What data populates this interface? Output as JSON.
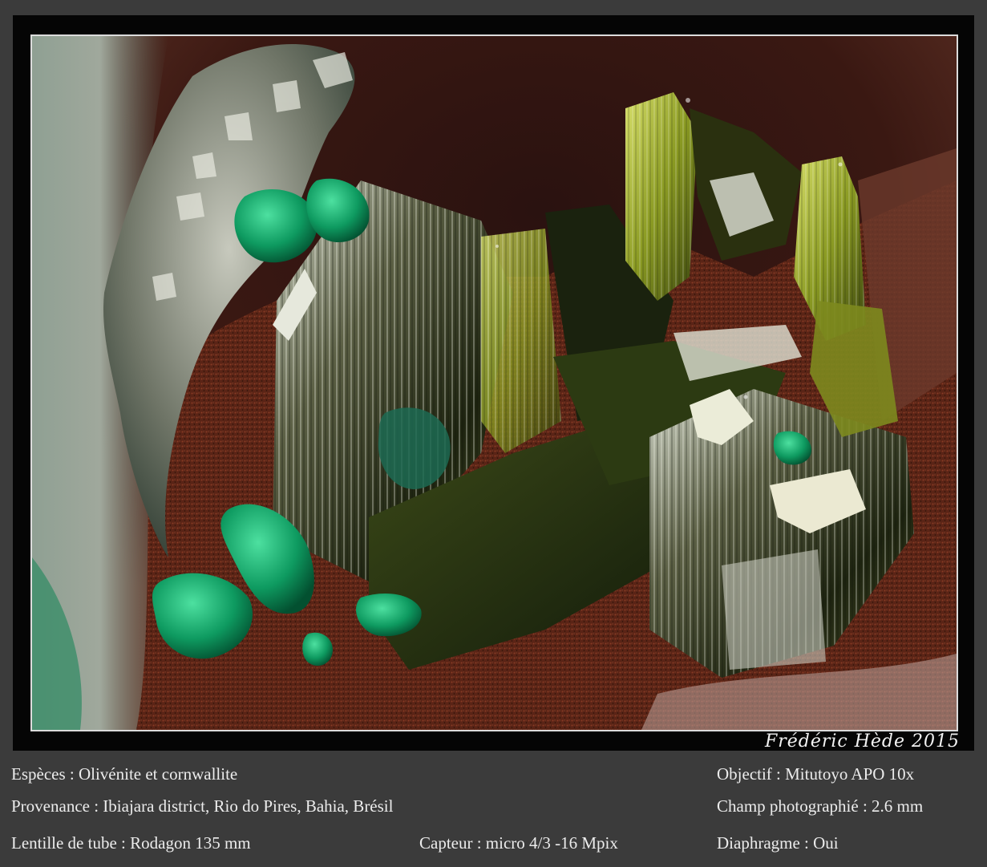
{
  "photo": {
    "subject": "mineral-specimen-photo"
  },
  "signature": "Frédéric Hède 2015",
  "captions": {
    "species": "Espèces : Olivénite et cornwallite",
    "provenance": "Provenance : Ibiajara district, Rio do Pires, Bahia, Brésil",
    "tube_lens": "Lentille de tube : Rodagon 135 mm",
    "sensor": "Capteur : micro 4/3 -16 Mpix",
    "objective": "Objectif : Mitutoyo APO 10x",
    "field": "Champ photographié : 2.6 mm",
    "aperture": "Diaphragme : Oui"
  },
  "colors": {
    "background": "#3b3b3b",
    "frame": "#050505",
    "mat": "#dcdcdc",
    "olivenite": "#6f7a1e",
    "cornwallite": "#0f9a5e",
    "matrix": "#5a2416",
    "text": "#ececec"
  }
}
